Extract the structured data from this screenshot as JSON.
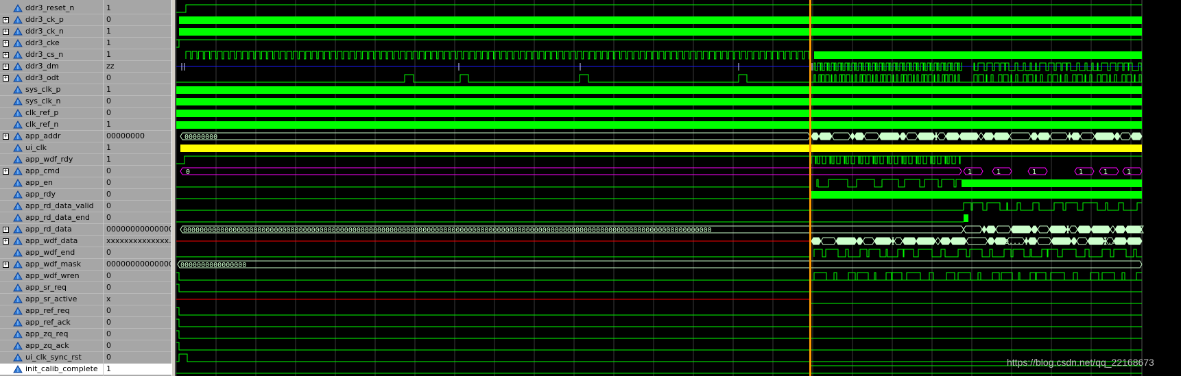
{
  "colors": {
    "wave_green": "#00ff00",
    "wave_pale": "#ccffcc",
    "bus_dark": "#1a1aff",
    "bus_magenta": "#ff00ff",
    "unknown_red": "#ff0000",
    "clock_yellow": "#ffff00",
    "cursor": "#ff9900",
    "grid": "#3a3a3a"
  },
  "signals": [
    {
      "name": "ddr3_reset_n",
      "value": "1",
      "bus": false
    },
    {
      "name": "ddr3_ck_p",
      "value": "0",
      "bus": true
    },
    {
      "name": "ddr3_ck_n",
      "value": "1",
      "bus": true
    },
    {
      "name": "ddr3_cke",
      "value": "1",
      "bus": true
    },
    {
      "name": "ddr3_cs_n",
      "value": "1",
      "bus": true
    },
    {
      "name": "ddr3_dm",
      "value": "zz",
      "bus": true
    },
    {
      "name": "ddr3_odt",
      "value": "0",
      "bus": true
    },
    {
      "name": "sys_clk_p",
      "value": "1",
      "bus": false
    },
    {
      "name": "sys_clk_n",
      "value": "0",
      "bus": false
    },
    {
      "name": "clk_ref_p",
      "value": "0",
      "bus": false
    },
    {
      "name": "clk_ref_n",
      "value": "1",
      "bus": false
    },
    {
      "name": "app_addr",
      "value": "00000000",
      "bus": true
    },
    {
      "name": "ui_clk",
      "value": "1",
      "bus": false
    },
    {
      "name": "app_wdf_rdy",
      "value": "1",
      "bus": false
    },
    {
      "name": "app_cmd",
      "value": "0",
      "bus": true
    },
    {
      "name": "app_en",
      "value": "0",
      "bus": false
    },
    {
      "name": "app_rdy",
      "value": "0",
      "bus": false
    },
    {
      "name": "app_rd_data_valid",
      "value": "0",
      "bus": false
    },
    {
      "name": "app_rd_data_end",
      "value": "0",
      "bus": false
    },
    {
      "name": "app_rd_data",
      "value": "00000000000000...",
      "bus": true
    },
    {
      "name": "app_wdf_data",
      "value": "xxxxxxxxxxxxxx...",
      "bus": true
    },
    {
      "name": "app_wdf_end",
      "value": "0",
      "bus": false
    },
    {
      "name": "app_wdf_mask",
      "value": "0000000000000000",
      "bus": true
    },
    {
      "name": "app_wdf_wren",
      "value": "0",
      "bus": false
    },
    {
      "name": "app_sr_req",
      "value": "0",
      "bus": false
    },
    {
      "name": "app_sr_active",
      "value": "x",
      "bus": false
    },
    {
      "name": "app_ref_req",
      "value": "0",
      "bus": false
    },
    {
      "name": "app_ref_ack",
      "value": "0",
      "bus": false
    },
    {
      "name": "app_zq_req",
      "value": "0",
      "bus": false
    },
    {
      "name": "app_zq_ack",
      "value": "0",
      "bus": false
    },
    {
      "name": "ui_clk_sync_rst",
      "value": "0",
      "bus": false
    },
    {
      "name": "init_calib_complete",
      "value": "1",
      "bus": false
    }
  ],
  "bus_labels": {
    "app_addr": "00000000",
    "app_cmd": "0",
    "app_cmd_repeat": "1",
    "app_rd_data": "00000000000000000000000000000000000000000000000000000000000000000000000000000000000000000000000000000000000000000000000000000000",
    "app_wdf_data_repeat": "0...",
    "app_wdf_mask": "0000000000000000"
  },
  "watermark": "https://blog.csdn.net/qq_22168673"
}
